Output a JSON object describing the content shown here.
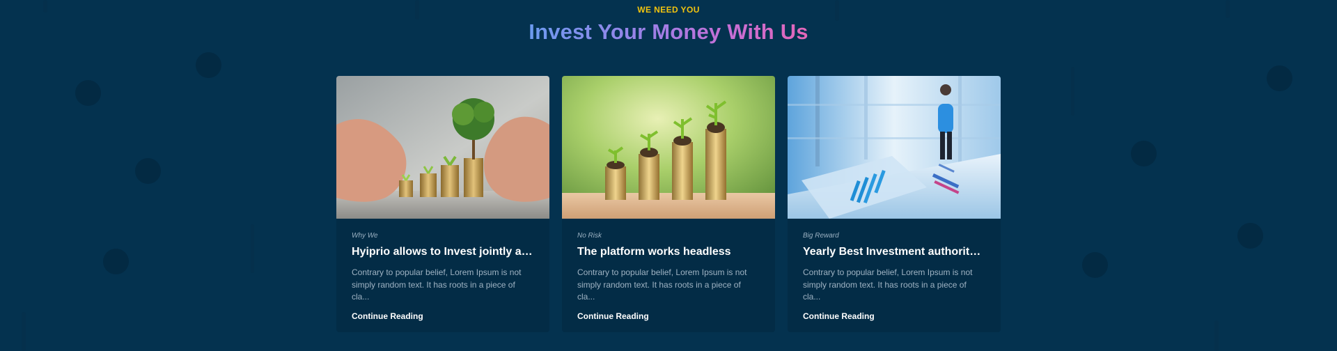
{
  "section": {
    "eyebrow": "WE NEED YOU",
    "title": "Invest Your Money With Us"
  },
  "colors": {
    "background": "#04324f",
    "card_background": "#032c46",
    "eyebrow": "#f2c40f",
    "title_gradient": [
      "#6c9bf0",
      "#c56fd6",
      "#e467b8"
    ]
  },
  "cards": [
    {
      "image": "hands-protecting-coin-stacks-with-tree-image",
      "category": "Why We",
      "title": "Hyiprio allows to Invest jointly all t...",
      "excerpt": "Contrary to popular belief, Lorem Ipsum is not simply random text. It has roots in a piece of cla...",
      "link": "Continue Reading"
    },
    {
      "image": "growing-coin-stacks-with-seedlings-image",
      "category": "No Risk",
      "title": "The platform works headless",
      "excerpt": "Contrary to popular belief, Lorem Ipsum is not simply random text. It has roots in a piece of cla...",
      "link": "Continue Reading"
    },
    {
      "image": "businessman-window-charts-image",
      "category": "Big Reward",
      "title": "Yearly Best Investment authority ...",
      "excerpt": "Contrary to popular belief, Lorem Ipsum is not simply random text. It has roots in a piece of cla...",
      "link": "Continue Reading"
    }
  ]
}
